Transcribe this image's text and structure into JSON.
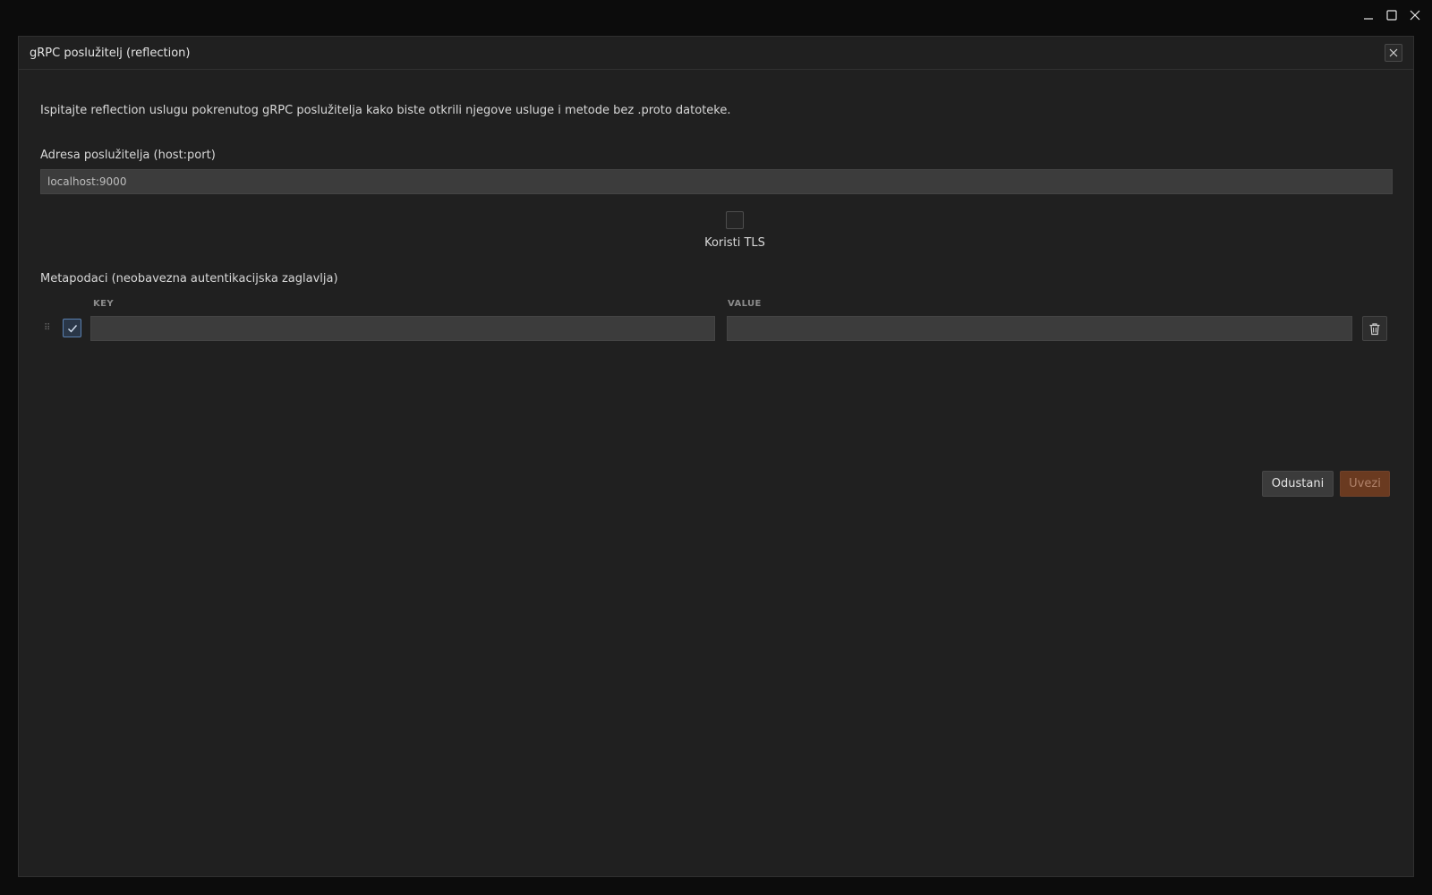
{
  "window": {
    "controls": [
      "minimize-icon",
      "maximize-icon",
      "close-icon"
    ]
  },
  "dialog": {
    "title": "gRPC poslužitelj (reflection)",
    "description": "Ispitajte reflection uslugu pokrenutog gRPC poslužitelja kako biste otkrili njegove usluge i metode bez .proto datoteke.",
    "address": {
      "label": "Adresa poslužitelja (host:port)",
      "value": "localhost:9000"
    },
    "tls": {
      "label": "Koristi TLS",
      "checked": false
    },
    "metadata": {
      "label": "Metapodaci (neobavezna autentikacijska zaglavlja)",
      "columns": {
        "key": "KEY",
        "value": "VALUE"
      },
      "rows": [
        {
          "enabled": true,
          "key": "",
          "value": ""
        }
      ]
    },
    "actions": {
      "cancel": "Odustani",
      "connect": "Uvezi"
    }
  },
  "colors": {
    "accent": "#6a3a20",
    "checkbox_accent": "#5a80b0",
    "dialog_bg": "#202020",
    "input_bg": "#3c3c3c"
  }
}
